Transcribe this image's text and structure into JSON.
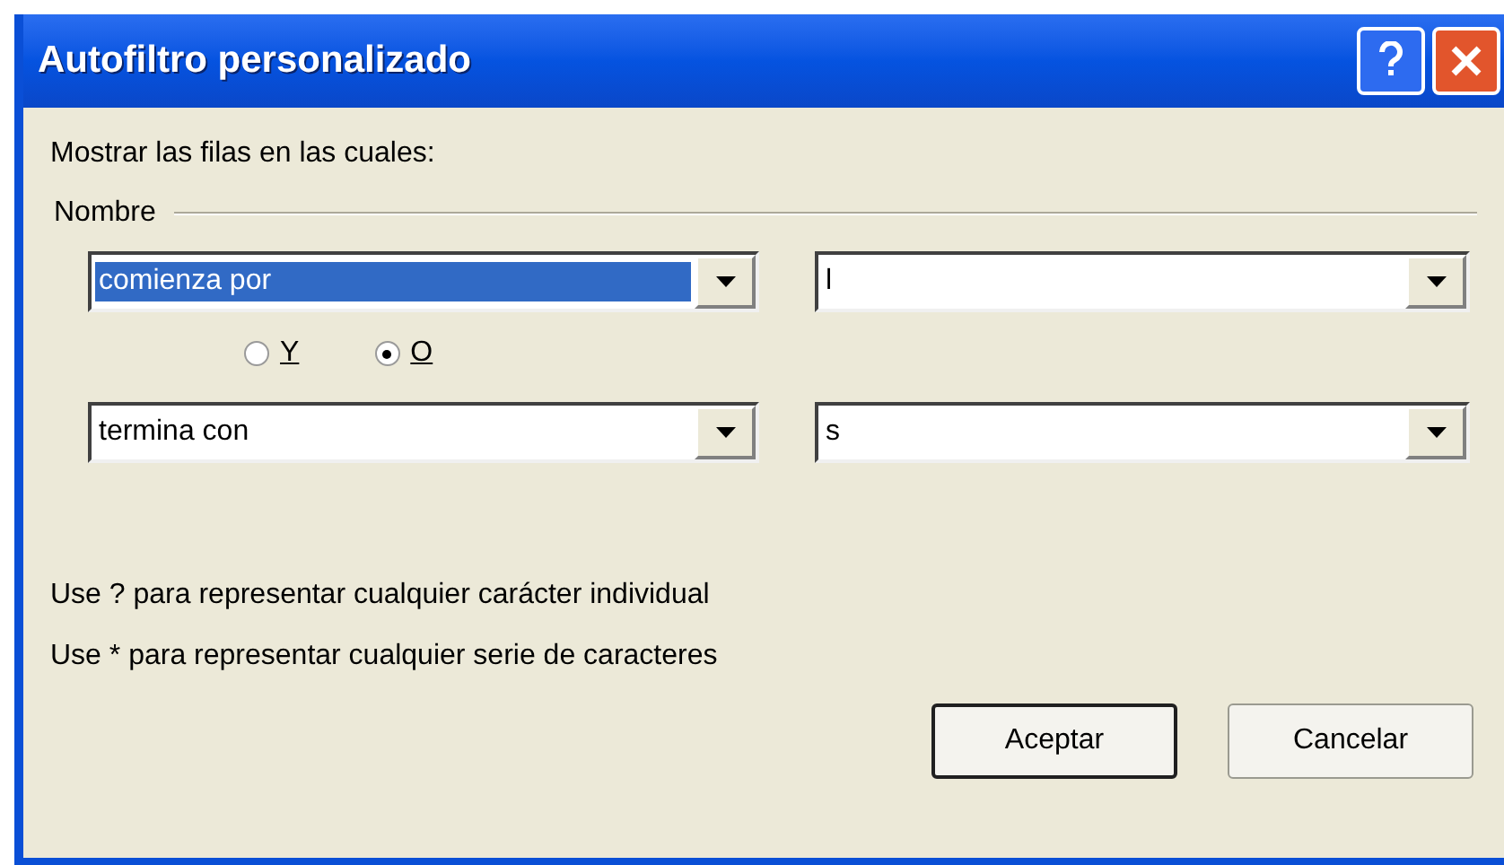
{
  "window": {
    "title": "Autofiltro personalizado"
  },
  "prompt": "Mostrar las filas en las cuales:",
  "group": {
    "label": "Nombre"
  },
  "conditions": [
    {
      "operator": "comienza por",
      "operator_focused": true,
      "value": "l"
    },
    {
      "operator": "termina con",
      "operator_focused": false,
      "value": "s"
    }
  ],
  "logic": [
    {
      "label": "Y",
      "selected": false
    },
    {
      "label": "O",
      "selected": true
    }
  ],
  "hints": [
    "Use ? para representar cualquier carácter individual",
    "Use * para representar cualquier serie de caracteres"
  ],
  "buttons": [
    {
      "label": "Aceptar",
      "default": true
    },
    {
      "label": "Cancelar",
      "default": false
    }
  ]
}
